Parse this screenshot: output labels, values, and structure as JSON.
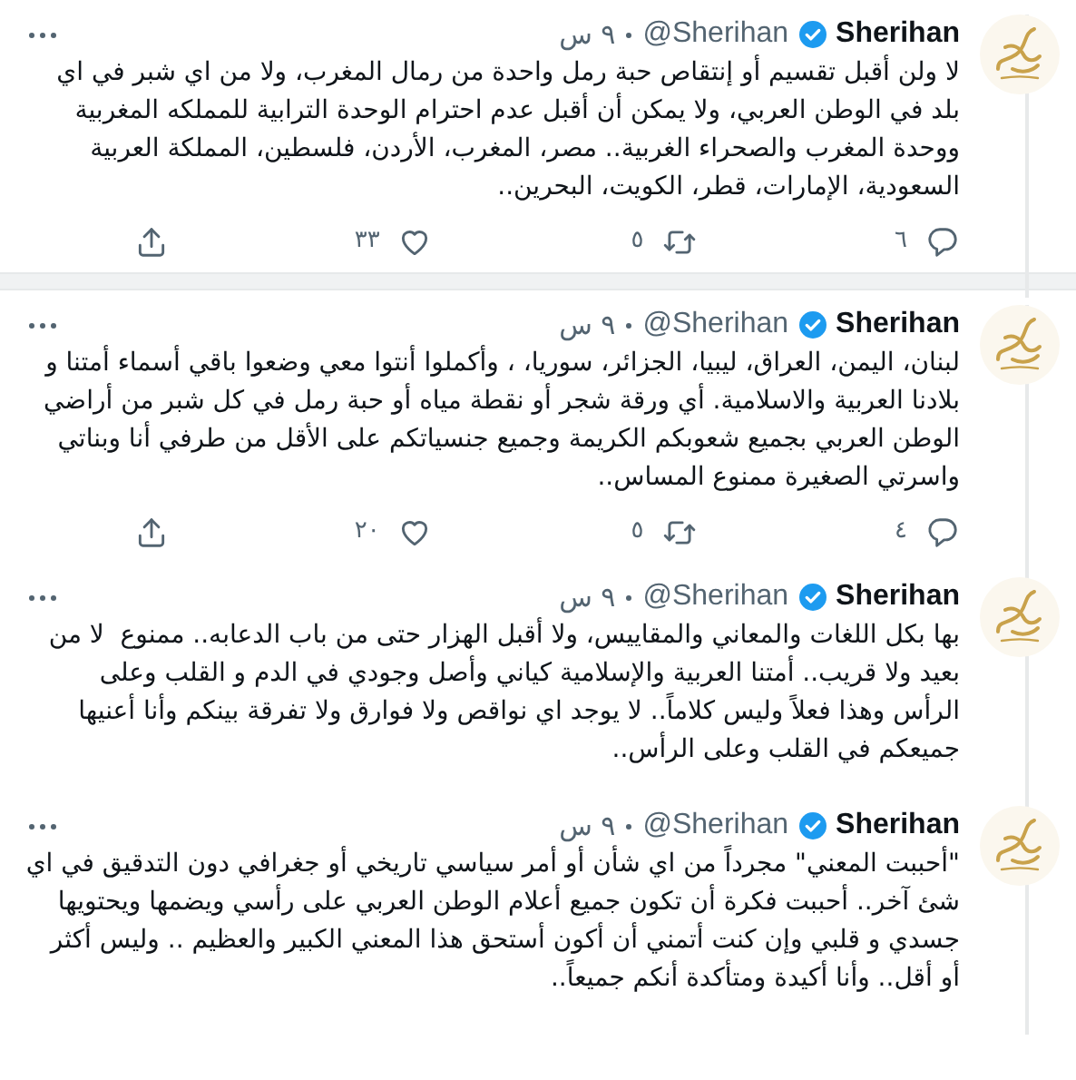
{
  "tweets": [
    {
      "author": {
        "name": "Sherihan",
        "handle": "@Sherihan",
        "verified": true
      },
      "time": "٩ س",
      "text": "لا ولن أقبل تقسيم أو إنتقاص حبة رمل واحدة من رمال المغرب، ولا من اي شبر في اي بلد في الوطن العربي، ولا يمكن أن أقبل عدم احترام الوحدة الترابية للمملكه المغربية ووحدة المغرب والصحراء الغربية.. مصر، المغرب، الأردن، فلسطين، المملكة العربية السعودية، الإمارات، قطر، الكويت، البحرين..",
      "actions": {
        "replies": "٦",
        "retweets": "٥",
        "likes": "٣٣"
      }
    },
    {
      "author": {
        "name": "Sherihan",
        "handle": "@Sherihan",
        "verified": true
      },
      "time": "٩ س",
      "text": "لبنان، اليمن، العراق، ليبيا، الجزائر، سوريا، ، وأكملوا أنتوا معي وضعوا باقي أسماء أمتنا و بلادنا العربية والاسلامية. أي ورقة شجر أو نقطة مياه أو حبة رمل في كل شبر من أراضي الوطن العربي بجميع شعوبكم الكريمة وجميع جنسياتكم على الأقل من طرفي أنا وبناتي واسرتي الصغيرة ممنوع المساس..",
      "actions": {
        "replies": "٤",
        "retweets": "٥",
        "likes": "٢٠"
      }
    },
    {
      "author": {
        "name": "Sherihan",
        "handle": "@Sherihan",
        "verified": true
      },
      "time": "٩ س",
      "text": "بها بكل اللغات والمعاني والمقاييس، ولا أقبل الهزار حتى من باب الدعابه.. ممنوع  لا من بعيد ولا قريب.. أمتنا العربية والإسلامية كياني وأصل وجودي في الدم و القلب وعلى الرأس وهذا فعلاً وليس كلاماً.. لا يوجد اي نواقص ولا فوارق ولا تفرقة بينكم وأنا أعنيها جميعكم في القلب وعلى الرأس.."
    },
    {
      "author": {
        "name": "Sherihan",
        "handle": "@Sherihan",
        "verified": true
      },
      "time": "٩ س",
      "text": "\"أحببت المعني\" مجرداً من اي شأن أو أمر سياسي تاريخي أو جغرافي دون التدقيق في اي شئ آخر.. أحببت فكرة أن تكون جميع أعلام الوطن العربي على رأسي ويضمها ويحتويها جسدي و قلبي وإن كنت أتمني أن أكون أستحق هذا المعني الكبير والعظيم .. وليس أكثر أو أقل.. وأنا أكيدة ومتأكدة أنكم جميعاً.."
    }
  ]
}
